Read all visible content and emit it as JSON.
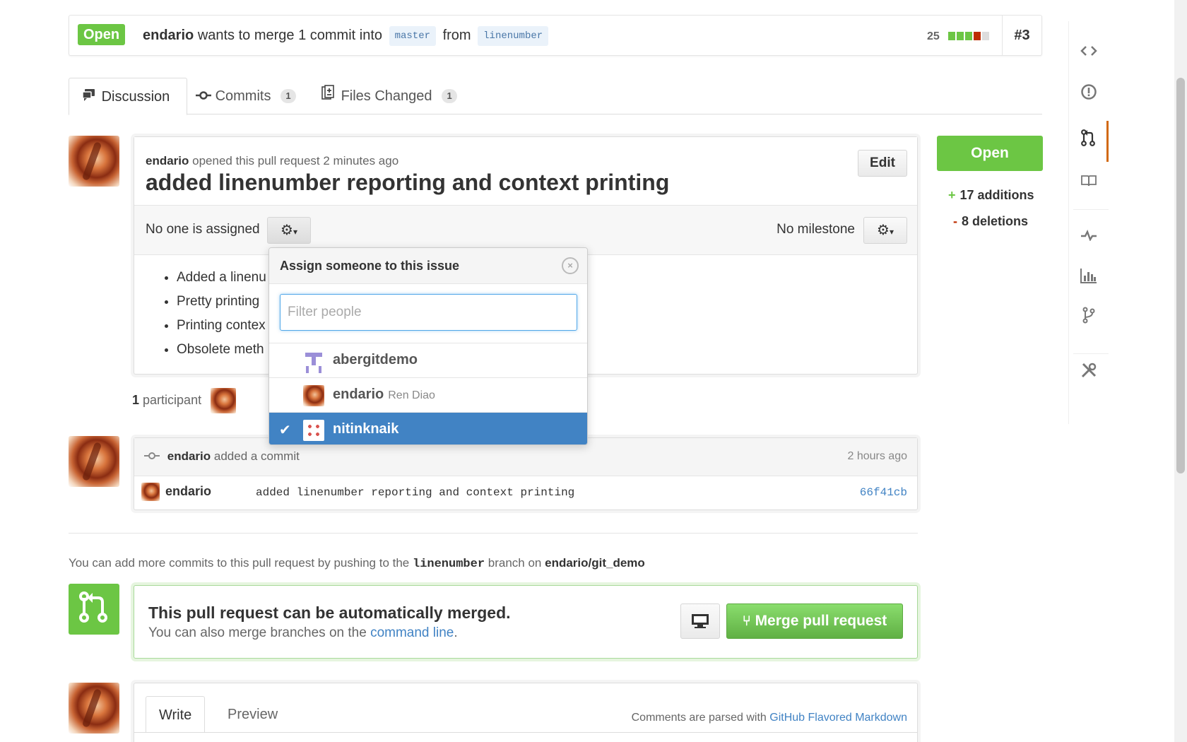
{
  "header": {
    "state": "Open",
    "author": "endario",
    "merge_text_1": "wants to merge 1 commit into",
    "base_branch": "master",
    "merge_text_2": "from",
    "head_branch": "linenumber",
    "diff_count": "25",
    "pr_number": "#3"
  },
  "tabs": [
    {
      "label": "Discussion",
      "icon": "comment-discussion-icon",
      "count": null
    },
    {
      "label": "Commits",
      "icon": "git-commit-icon",
      "count": "1"
    },
    {
      "label": "Files Changed",
      "icon": "diff-icon",
      "count": "1"
    }
  ],
  "discussion": {
    "author": "endario",
    "opened_text": "opened this pull request 2 minutes ago",
    "title": "added linenumber reporting and context printing",
    "edit_label": "Edit",
    "assignee_text": "No one is assigned",
    "milestone_text": "No milestone",
    "body_items": [
      "Added a linenu",
      "Pretty printing",
      "Printing contex",
      "Obsolete meth"
    ]
  },
  "participants": {
    "count": "1",
    "label": "participant"
  },
  "assign_dropdown": {
    "title": "Assign someone to this issue",
    "filter_placeholder": "Filter people",
    "people": [
      {
        "login": "abergitdemo",
        "full_name": "",
        "selected": false
      },
      {
        "login": "endario",
        "full_name": "Ren Diao",
        "selected": false
      },
      {
        "login": "nitinknaik",
        "full_name": "",
        "selected": true
      }
    ]
  },
  "commit_event": {
    "author": "endario",
    "action": "added a commit",
    "time": "2 hours ago",
    "row_author": "endario",
    "message": "added linenumber reporting and context printing",
    "sha": "66f41cb"
  },
  "push_note": {
    "prefix": "You can add more commits to this pull request by pushing to the",
    "branch": "linenumber",
    "middle": "branch on",
    "repo": "endario/git_demo"
  },
  "merge": {
    "title": "This pull request can be automatically merged.",
    "sub_prefix": "You can also merge branches on the",
    "sub_link": "command line",
    "sub_suffix": ".",
    "button_label": "Merge pull request"
  },
  "comment": {
    "write_tab": "Write",
    "preview_tab": "Preview",
    "md_prefix": "Comments are parsed with",
    "md_link": "GitHub Flavored Markdown"
  },
  "sidebar": {
    "state": "Open",
    "additions": "17 additions",
    "deletions": "8 deletions"
  },
  "rail": [
    "code-icon",
    "issue-icon",
    "pull-request-icon",
    "wiki-icon",
    "pulse-icon",
    "graph-icon",
    "network-icon",
    "settings-icon"
  ],
  "colors": {
    "open_green": "#6cc644",
    "link_blue": "#4183c4",
    "selected_blue": "#4183c4",
    "active_tab_orange": "#d26911",
    "deletion_red": "#bd2c00"
  }
}
